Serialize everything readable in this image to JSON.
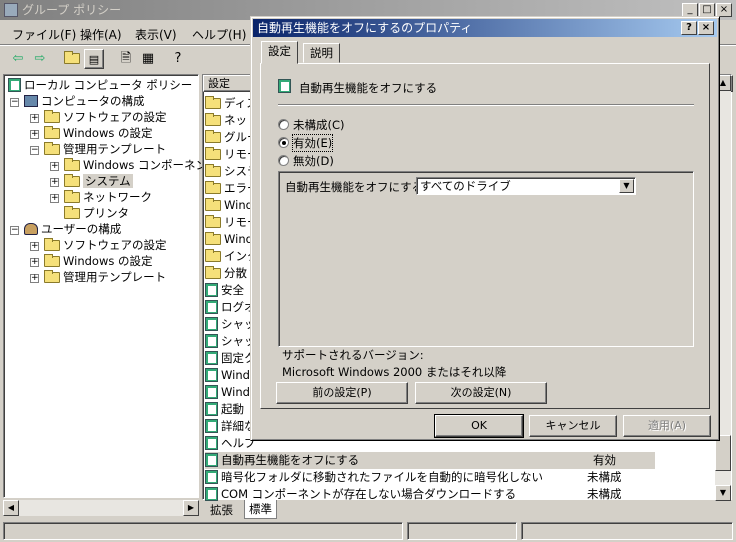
{
  "main_window": {
    "title": "グループ ポリシー",
    "controls": [
      "_",
      "□",
      "×"
    ]
  },
  "menubar": [
    {
      "label": "ファイル(F)"
    },
    {
      "label": "操作(A)"
    },
    {
      "label": "表示(V)"
    },
    {
      "label": "ヘルプ(H)"
    }
  ],
  "toolbar": {
    "icons": [
      "back-arrow-icon",
      "forward-arrow-icon",
      "up-folder-icon",
      "show-hide-tree-icon",
      "properties-icon",
      "export-list-icon",
      "help-icon"
    ]
  },
  "tree": {
    "items": [
      {
        "label": "ローカル コンピュータ ポリシー",
        "icon": "policy-icon"
      },
      {
        "label": "コンピュータの構成",
        "icon": "computer-icon"
      },
      {
        "label": "ソフトウェアの設定",
        "icon": "folder-icon"
      },
      {
        "label": "Windows の設定",
        "icon": "folder-icon"
      },
      {
        "label": "管理用テンプレート",
        "icon": "folder-icon"
      },
      {
        "label": "Windows コンポーネント",
        "icon": "folder-icon"
      },
      {
        "label": "システム",
        "icon": "folder-icon"
      },
      {
        "label": "ネットワーク",
        "icon": "folder-icon"
      },
      {
        "label": "プリンタ",
        "icon": "folder-icon"
      },
      {
        "label": "ユーザーの構成",
        "icon": "user-icon"
      },
      {
        "label": "ソフトウェアの設定",
        "icon": "folder-icon"
      },
      {
        "label": "Windows の設定",
        "icon": "folder-icon"
      },
      {
        "label": "管理用テンプレート",
        "icon": "folder-icon"
      }
    ]
  },
  "list": {
    "header": "設定",
    "rows": [
      {
        "name": "ディス"
      },
      {
        "name": "ネット"
      },
      {
        "name": "グルー"
      },
      {
        "name": "リモー"
      },
      {
        "name": "システ"
      },
      {
        "name": "エラー"
      },
      {
        "name": "Windo"
      },
      {
        "name": "リモー"
      },
      {
        "name": "Windo"
      },
      {
        "name": "インタ"
      },
      {
        "name": "分散"
      },
      {
        "name": "安全"
      },
      {
        "name": "ログオ"
      },
      {
        "name": "シャッ"
      },
      {
        "name": "シャッ"
      },
      {
        "name": "固定ク"
      },
      {
        "name": "Windo"
      },
      {
        "name": "Windo"
      },
      {
        "name": "起動"
      },
      {
        "name": "詳細な"
      },
      {
        "name": "ヘルプ"
      },
      {
        "name": "自動再生機能をオフにする",
        "state": "有効"
      },
      {
        "name": "暗号化フォルダに移動されたファイルを自動的に暗号化しない",
        "state": "未構成"
      },
      {
        "name": "COM コンポーネントが存在しない場合ダウンロードする",
        "state": "未構成"
      }
    ],
    "partial_hidden_row_text": "ヘルプ ...する"
  },
  "bottom_tabs": [
    "拡張",
    "標準"
  ],
  "dialog": {
    "title": "自動再生機能をオフにするのプロパティ",
    "title_buttons": [
      "?",
      "×"
    ],
    "tabs": [
      "設定",
      "説明"
    ],
    "policy_name": "自動再生機能をオフにする",
    "radios": [
      {
        "label": "未構成(C)",
        "checked": false
      },
      {
        "label": "有効(E)",
        "checked": true
      },
      {
        "label": "無効(D)",
        "checked": false
      }
    ],
    "option_label": "自動再生機能をオフにする:",
    "option_value": "すべてのドライブ",
    "supported_label": "サポートされるバージョン:",
    "supported_value": "Microsoft Windows 2000 またはそれ以降",
    "prev_button": "前の設定(P)",
    "next_button": "次の設定(N)",
    "ok_button": "OK",
    "cancel_button": "キャンセル",
    "apply_button": "適用(A)"
  }
}
